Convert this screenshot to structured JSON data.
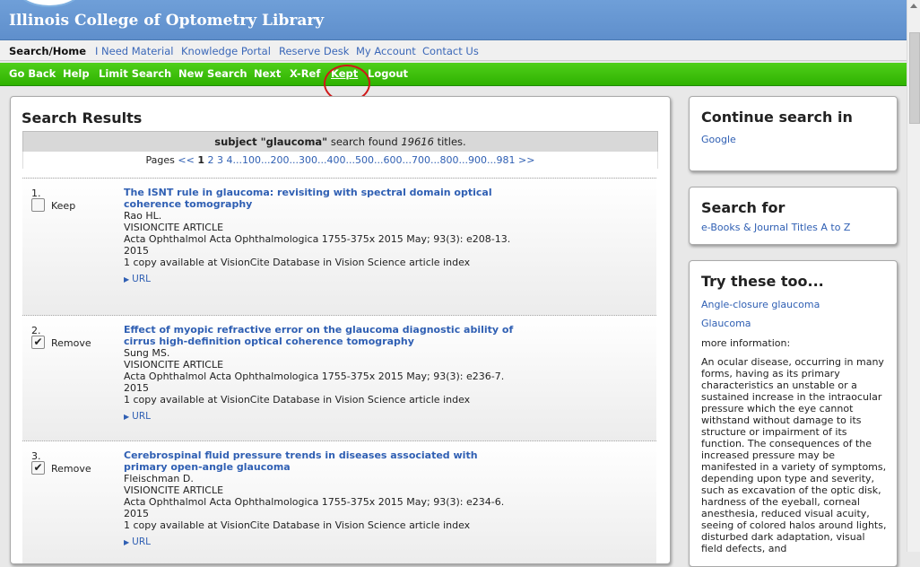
{
  "header": {
    "title": "Illinois College of Optometry Library"
  },
  "topnav": [
    {
      "label": "Search/Home",
      "active": true
    },
    {
      "label": "I Need Material"
    },
    {
      "label": "Knowledge Portal"
    },
    {
      "label": "Reserve Desk"
    },
    {
      "label": "My Account"
    },
    {
      "label": "Contact Us"
    }
  ],
  "toolbar": [
    "Go Back",
    "Help",
    "Limit Search",
    "New Search",
    "Next",
    "X-Ref",
    "Kept",
    "Logout"
  ],
  "results": {
    "title": "Search Results",
    "summary": {
      "query_type": "subject",
      "query": "\"glaucoma\"",
      "found_text": "search found",
      "count": "19616",
      "suffix": "titles."
    },
    "pages": {
      "label": "Pages",
      "prev": "<<",
      "current": "1",
      "links": [
        "2",
        "3",
        "4",
        "...100",
        "...200",
        "...300",
        "...400",
        "...500",
        "...600",
        "...700",
        "...800",
        "...900",
        "...981"
      ],
      "next": ">>"
    },
    "items": [
      {
        "num": "1.",
        "checked": false,
        "action": "Keep",
        "title": "The ISNT rule in glaucoma: revisiting with spectral domain optical coherence tomography",
        "author": "Rao HL.",
        "type": "VISIONCITE ARTICLE",
        "source": "Acta Ophthalmol Acta Ophthalmologica 1755-375x 2015 May; 93(3): e208-13.",
        "year": "2015",
        "availability": "1 copy available at VisionCite Database in Vision Science article index",
        "url_label": "URL"
      },
      {
        "num": "2.",
        "checked": true,
        "action": "Remove",
        "title": "Effect of myopic refractive error on the glaucoma diagnostic ability of cirrus high-definition optical coherence tomography",
        "author": "Sung MS.",
        "type": "VISIONCITE ARTICLE",
        "source": "Acta Ophthalmol Acta Ophthalmologica 1755-375x 2015 May; 93(3): e236-7.",
        "year": "2015",
        "availability": "1 copy available at VisionCite Database in Vision Science article index",
        "url_label": "URL"
      },
      {
        "num": "3.",
        "checked": true,
        "action": "Remove",
        "title": "Cerebrospinal fluid pressure trends in diseases associated with primary open-angle glaucoma",
        "author": "Fleischman D.",
        "type": "VISIONCITE ARTICLE",
        "source": "Acta Ophthalmol Acta Ophthalmologica 1755-375x 2015 May; 93(3): e234-6.",
        "year": "2015",
        "availability": "1 copy available at VisionCite Database in Vision Science article index",
        "url_label": "URL"
      }
    ]
  },
  "continue_search": {
    "title": "Continue search in",
    "links": [
      "Google"
    ]
  },
  "search_for": {
    "title": "Search for",
    "link": "e-Books & Journal Titles A to Z"
  },
  "try_these": {
    "title": "Try these too...",
    "links": [
      "Angle-closure glaucoma",
      "Glaucoma"
    ],
    "more_info": "more information:",
    "description": "An ocular disease, occurring in many forms, having as its primary characteristics an unstable or a sustained increase in the intraocular pressure which the eye cannot withstand without damage to its structure or impairment of its function. The consequences of the increased pressure may be manifested in a variety of symptoms, depending upon type and severity, such as excavation of the optic disk, hardness of the eyeball, corneal anesthesia, reduced visual acuity, seeing of colored halos around lights, disturbed dark adaptation, visual field defects, and"
  },
  "colors": {
    "header": "#6f9fd8",
    "toolbar": "#3cc00a",
    "link": "#2f5fb3",
    "annotation": "#d01818"
  }
}
